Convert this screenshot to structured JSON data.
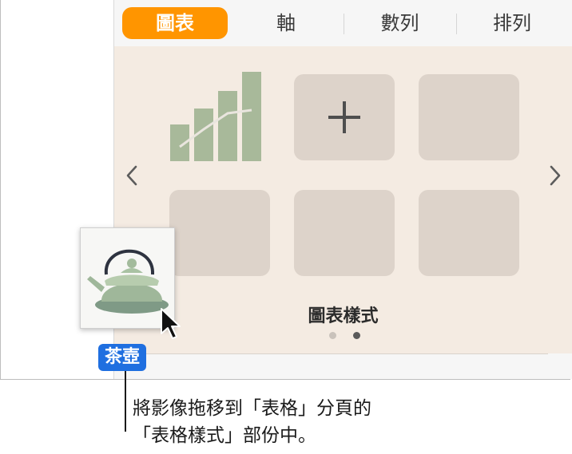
{
  "tabs": [
    {
      "label": "圖表",
      "active": true
    },
    {
      "label": "軸",
      "active": false
    },
    {
      "label": "數列",
      "active": false
    },
    {
      "label": "排列",
      "active": false
    }
  ],
  "styles_panel": {
    "caption": "圖表樣式",
    "prev_icon": "chevron-left-icon",
    "next_icon": "chevron-right-icon",
    "add_icon": "plus-icon",
    "page_dots": {
      "count": 2,
      "current": 2
    },
    "colors": {
      "panel_bg": "#f4ebe2",
      "tile_bg": "#ddd3ca",
      "chart_green": "#a8b99a",
      "accent": "#ff9500"
    }
  },
  "drag_item": {
    "label": "茶壺",
    "image": "teapot-image",
    "cursor_icon": "arrow-cursor-icon",
    "badge_color": "#1f6fe0"
  },
  "callout": {
    "line1": "將影像拖移到「表格」分頁的",
    "line2": "「表格樣式」部份中。"
  }
}
